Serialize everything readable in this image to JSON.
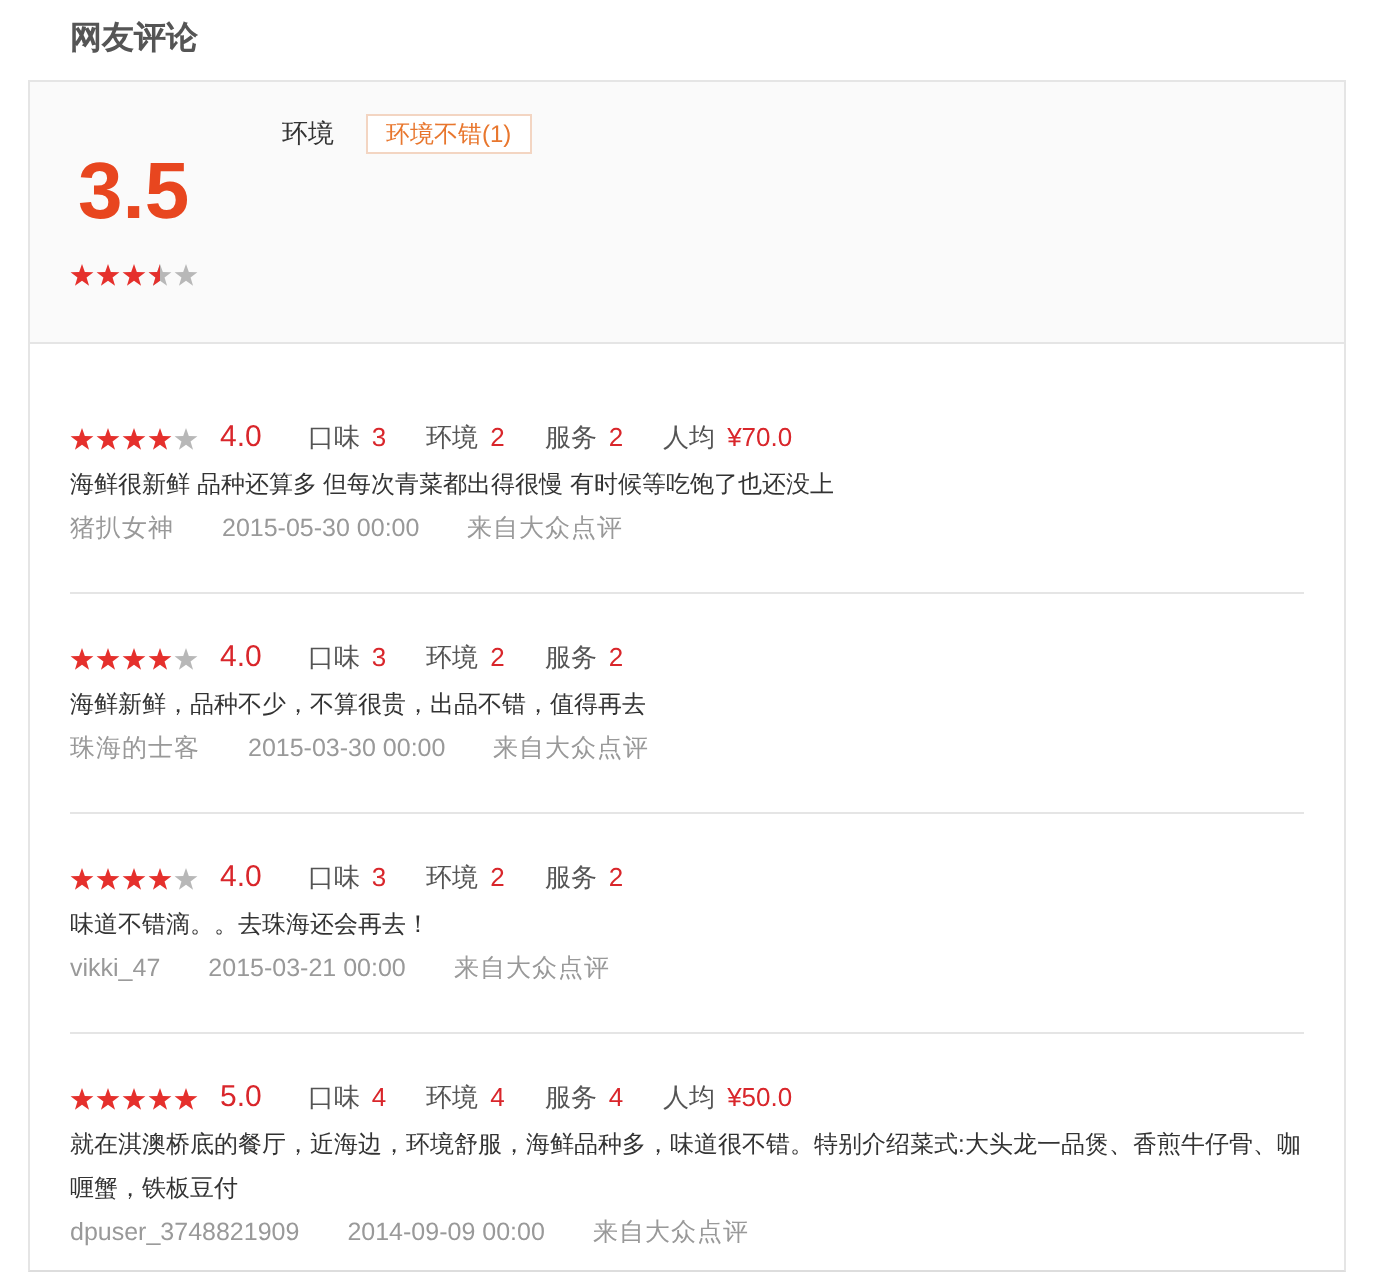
{
  "section": {
    "title": "网友评论"
  },
  "summary": {
    "score": "3.5",
    "stars": 3.5,
    "aspects": [
      {
        "label": "环境",
        "tags": [
          "环境不错(1)"
        ]
      }
    ]
  },
  "reviews": [
    {
      "stars": 4,
      "score": "4.0",
      "ratings": [
        {
          "label": "口味",
          "value": "3"
        },
        {
          "label": "环境",
          "value": "2"
        },
        {
          "label": "服务",
          "value": "2"
        },
        {
          "label": "人均",
          "value": "¥70.0"
        }
      ],
      "comment": "海鲜很新鲜 品种还算多 但每次青菜都出得很慢 有时候等吃饱了也还没上",
      "user": "猪扒女神",
      "date": "2015-05-30 00:00",
      "source": "来自大众点评"
    },
    {
      "stars": 4,
      "score": "4.0",
      "ratings": [
        {
          "label": "口味",
          "value": "3"
        },
        {
          "label": "环境",
          "value": "2"
        },
        {
          "label": "服务",
          "value": "2"
        }
      ],
      "comment": "海鲜新鲜，品种不少，不算很贵，出品不错，值得再去",
      "user": "珠海的士客",
      "date": "2015-03-30 00:00",
      "source": "来自大众点评"
    },
    {
      "stars": 4,
      "score": "4.0",
      "ratings": [
        {
          "label": "口味",
          "value": "3"
        },
        {
          "label": "环境",
          "value": "2"
        },
        {
          "label": "服务",
          "value": "2"
        }
      ],
      "comment": "味道不错滴。。去珠海还会再去！",
      "user": "vikki_47",
      "date": "2015-03-21 00:00",
      "source": "来自大众点评"
    },
    {
      "stars": 5,
      "score": "5.0",
      "ratings": [
        {
          "label": "口味",
          "value": "4"
        },
        {
          "label": "环境",
          "value": "4"
        },
        {
          "label": "服务",
          "value": "4"
        },
        {
          "label": "人均",
          "value": "¥50.0"
        }
      ],
      "comment": "就在淇澳桥底的餐厅，近海边，环境舒服，海鲜品种多，味道很不错。特别介绍菜式:大头龙一品煲、香煎牛仔骨、咖喱蟹，铁板豆付",
      "user": "dpuser_3748821909",
      "date": "2014-09-09 00:00",
      "source": "来自大众点评"
    }
  ]
}
